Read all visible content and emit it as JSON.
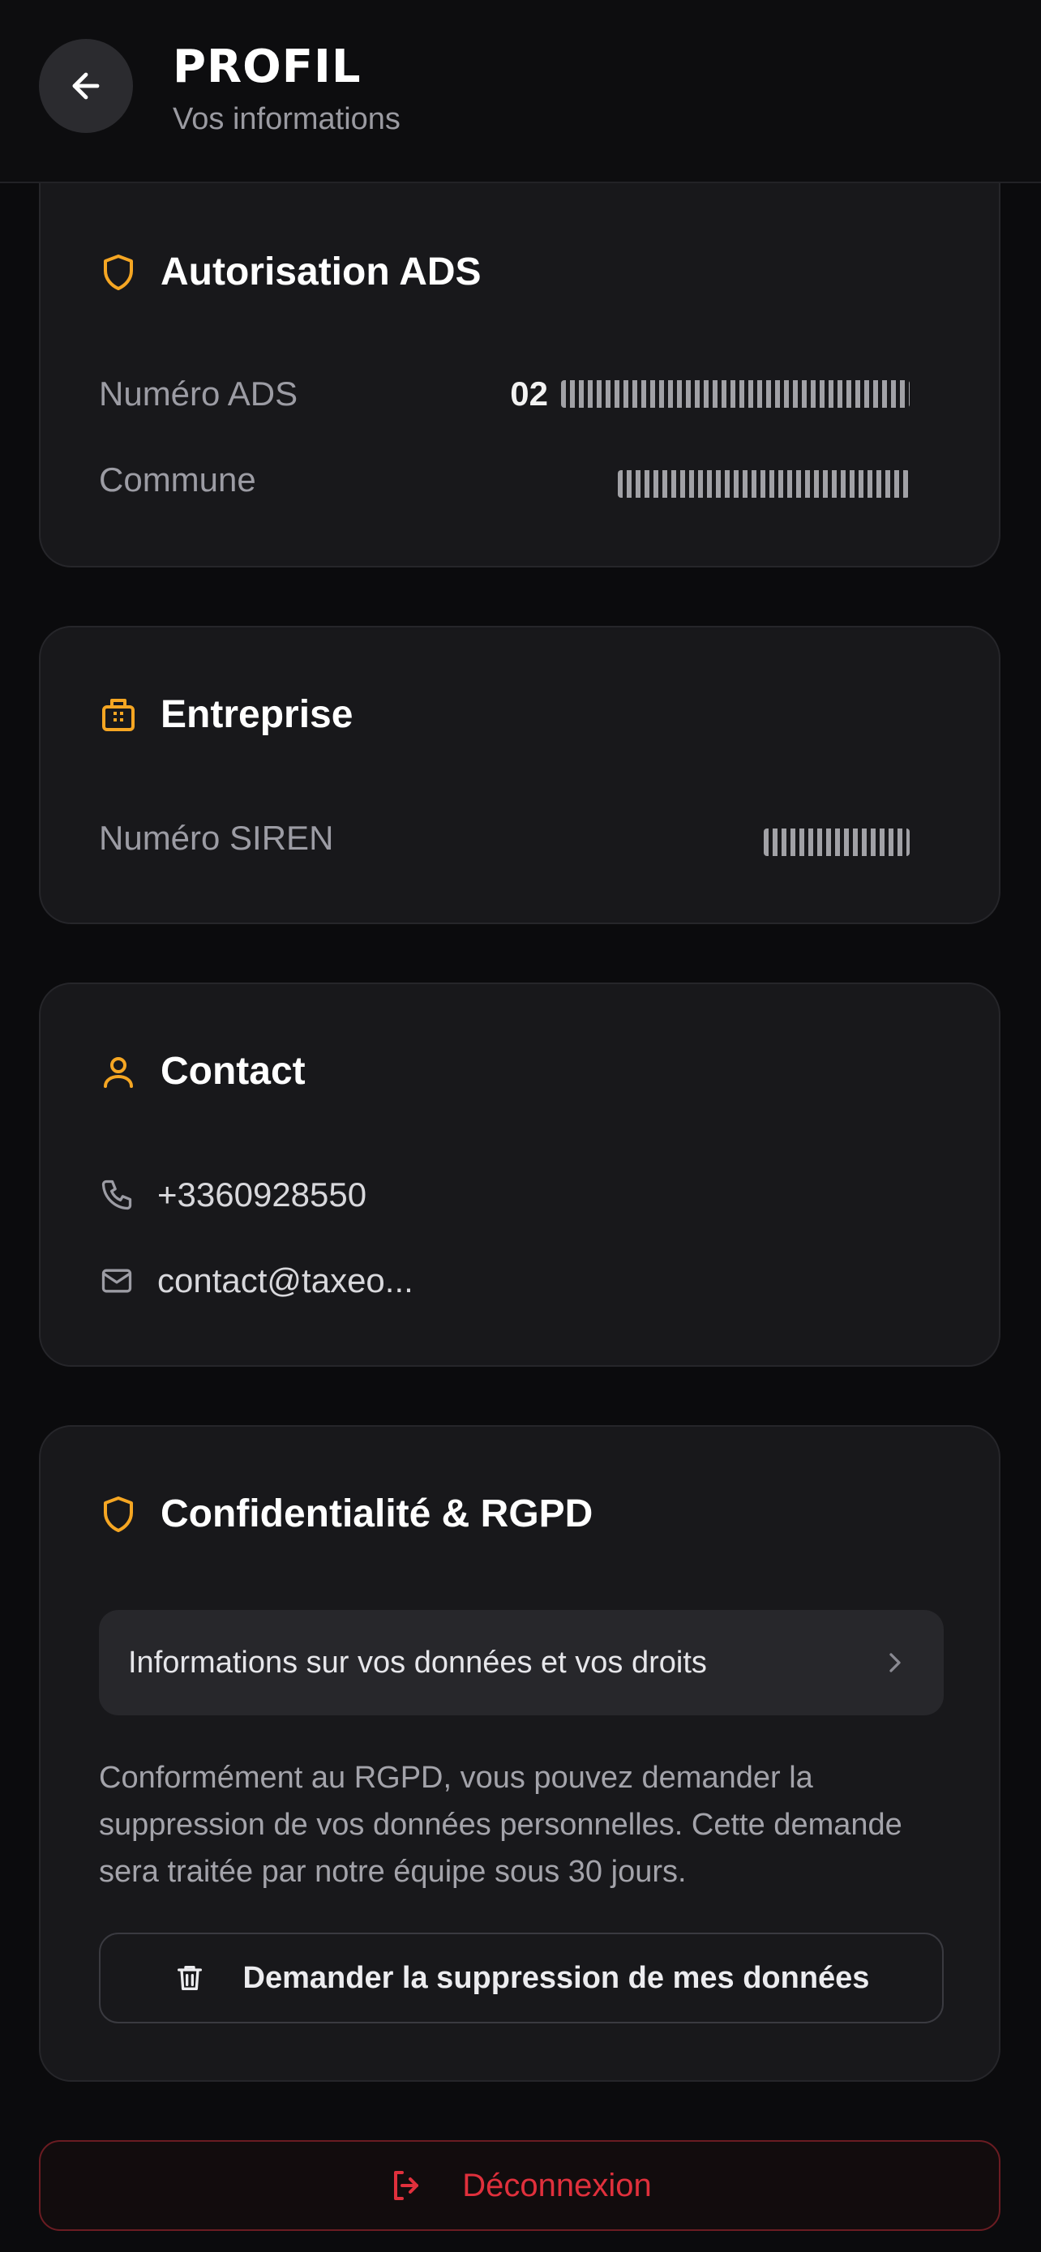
{
  "header": {
    "title": "PROFIL",
    "subtitle": "Vos informations"
  },
  "ads": {
    "title": "Autorisation ADS",
    "numero_label": "Numéro ADS",
    "numero_value_prefix": "02",
    "commune_label": "Commune"
  },
  "entreprise": {
    "title": "Entreprise",
    "siren_label": "Numéro SIREN"
  },
  "contact": {
    "title": "Contact",
    "phone": "+3360928550",
    "email": "contact@taxeo..."
  },
  "rgpd": {
    "title": "Confidentialité & RGPD",
    "info_button": "Informations sur vos données et vos droits",
    "description": "Conformément au RGPD, vous pouvez demander la suppression de vos données personnelles. Cette demande sera traitée par notre équipe sous 30 jours.",
    "delete_button": "Demander la suppression de mes données"
  },
  "logout": {
    "label": "Déconnexion"
  },
  "colors": {
    "accent": "#f5a623",
    "danger": "#e0303c",
    "card": "#18181b",
    "background": "#0b0b0d"
  },
  "icons": [
    "back-arrow-icon",
    "shield-icon",
    "building-icon",
    "user-icon",
    "phone-icon",
    "mail-icon",
    "chevron-right-icon",
    "trash-icon",
    "logout-icon"
  ]
}
